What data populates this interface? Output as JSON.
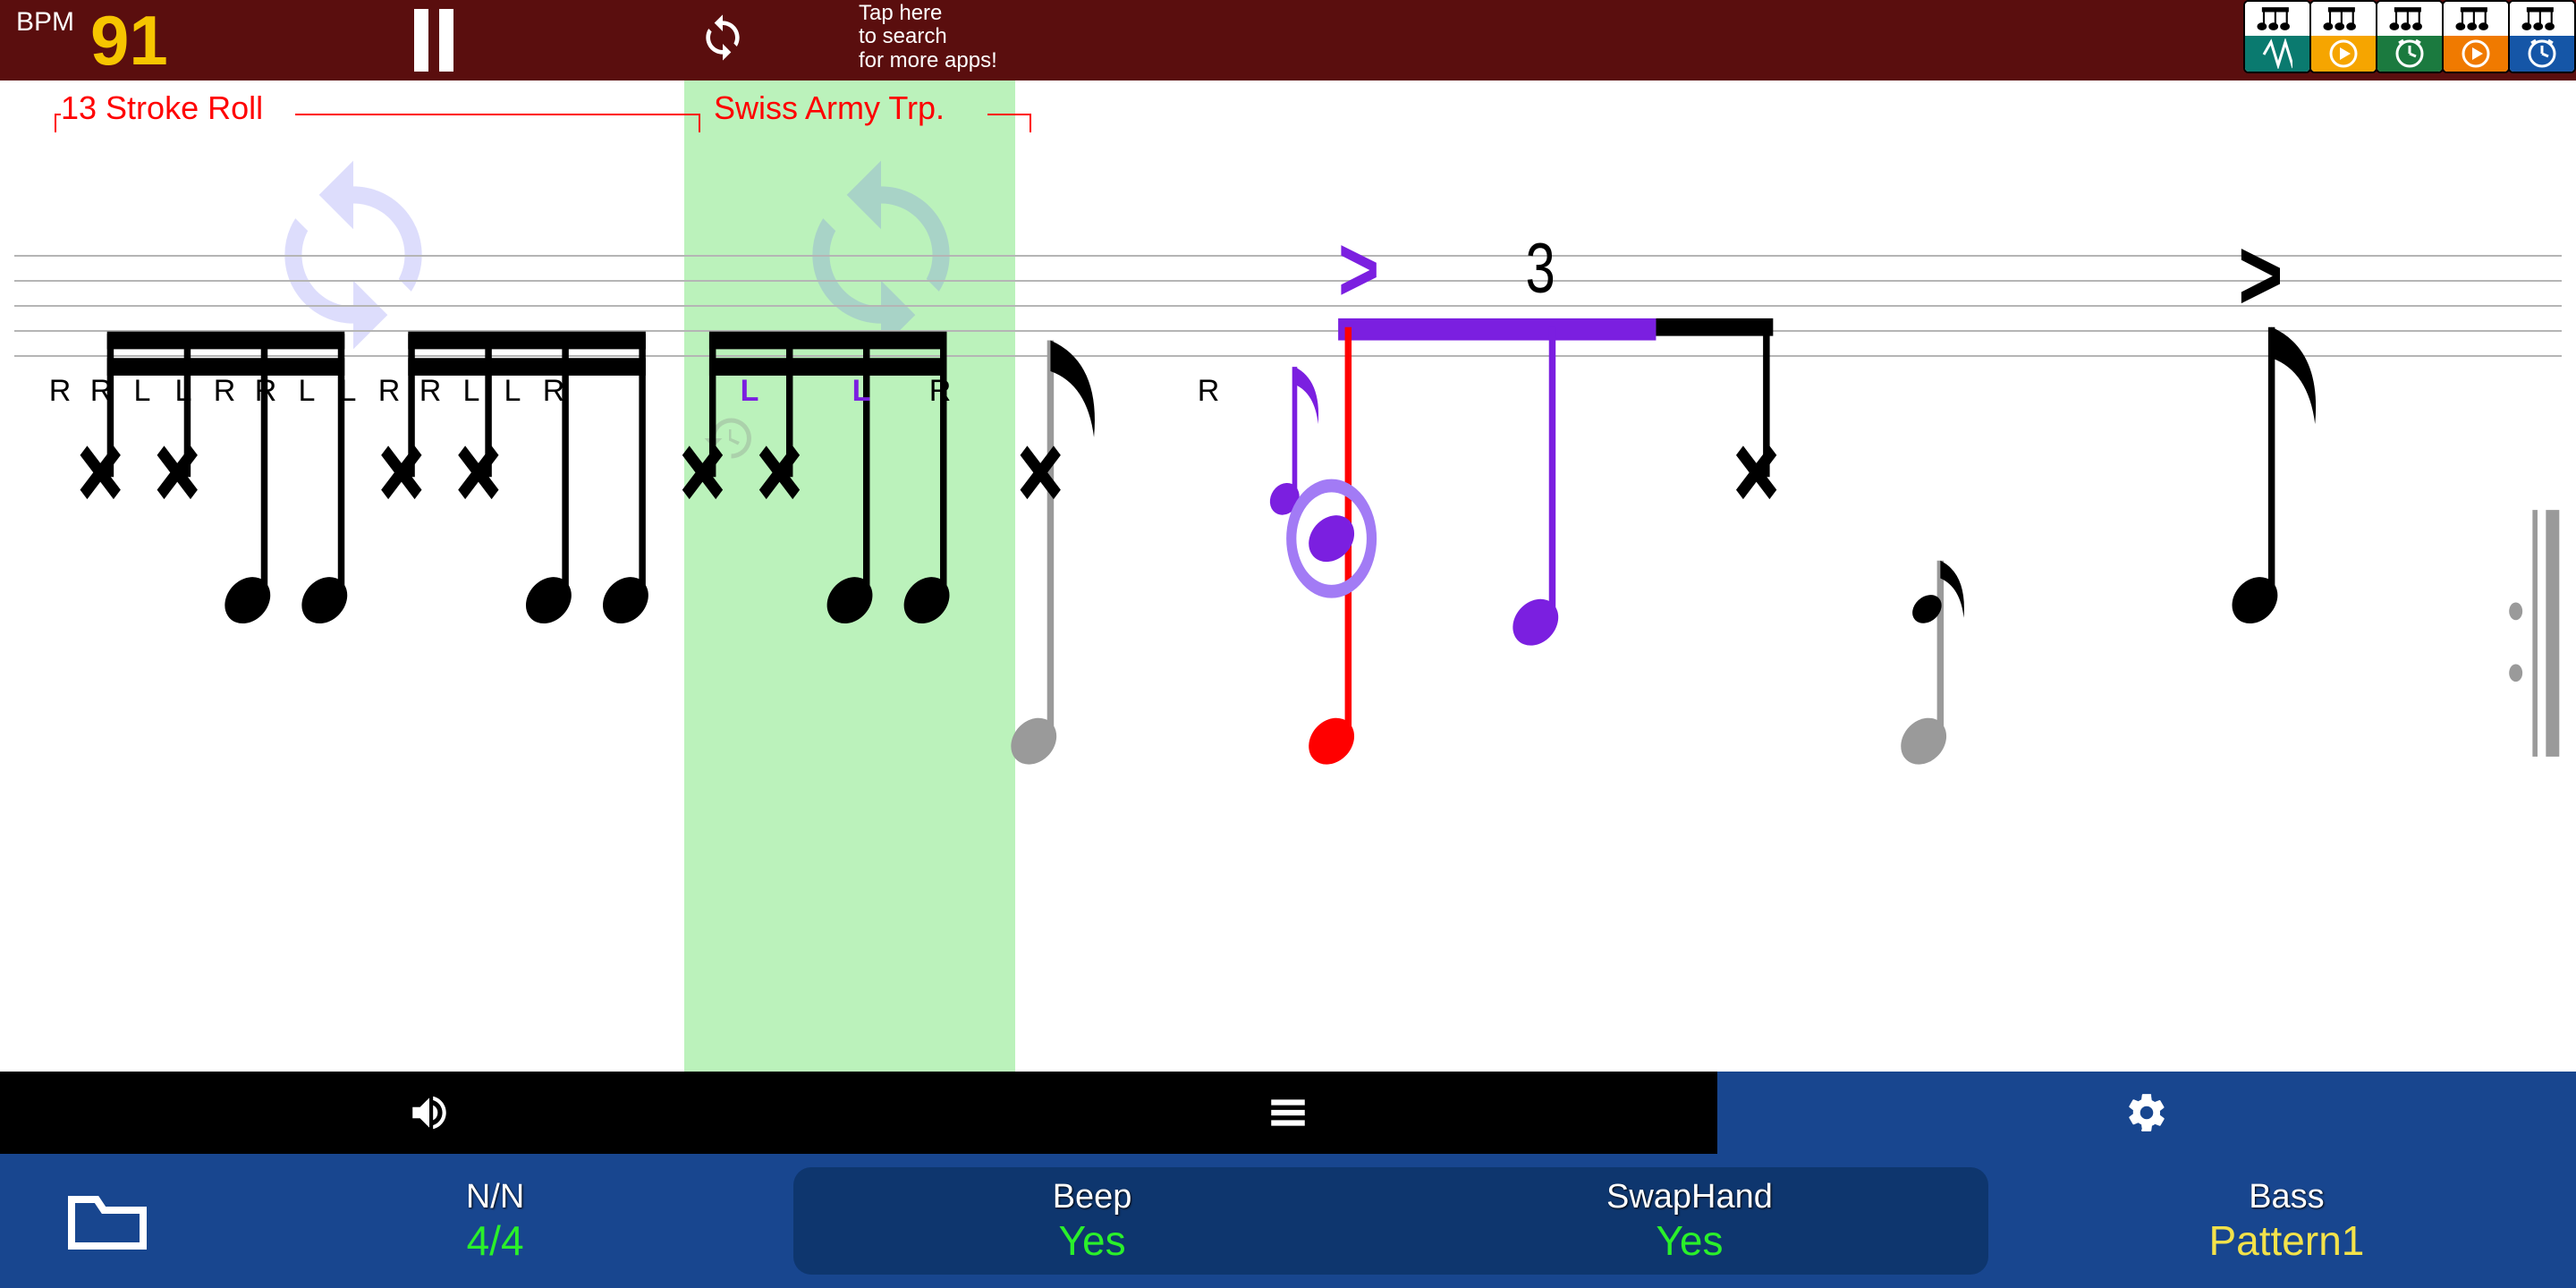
{
  "topbar": {
    "bpm_label": "BPM",
    "bpm_value": "91",
    "search_text": "Tap here\nto search\nfor more apps!"
  },
  "app_thumbs": [
    {
      "color": "#0a7a6f",
      "icon": "wave"
    },
    {
      "color": "#f6a500",
      "icon": "play"
    },
    {
      "color": "#1b7a3f",
      "icon": "clock"
    },
    {
      "color": "#f07a00",
      "icon": "play"
    },
    {
      "color": "#1556a7",
      "icon": "clock"
    }
  ],
  "score": {
    "title1": "13 Stroke Roll",
    "title2": " Swiss Army Trp. ",
    "tuplet_num": "3",
    "sticking1": [
      "R",
      "R",
      "L",
      "L",
      "R",
      "R",
      "L",
      "L",
      "R",
      "R",
      "L",
      "L",
      "R"
    ],
    "sticking2": [
      {
        "t": "L",
        "c": "purple"
      },
      {
        "t": "L",
        "c": "purple"
      },
      {
        "t": "R",
        "c": ""
      }
    ],
    "sticking3": [
      {
        "t": "R",
        "c": ""
      }
    ]
  },
  "tabs": [
    "sound",
    "list",
    "settings"
  ],
  "settings": {
    "nn_label": "N/N",
    "nn_value": "4/4",
    "beep_label": "Beep",
    "beep_value": "Yes",
    "swap_label": "SwapHand",
    "swap_value": "Yes",
    "bass_label": "Bass",
    "bass_value": "Pattern1"
  }
}
